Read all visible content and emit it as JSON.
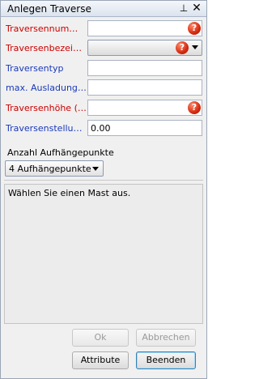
{
  "window": {
    "title": "Anlegen Traverse",
    "pin_glyph": "⊥",
    "close_glyph": "✕"
  },
  "fields": [
    {
      "label": "Traversennummer",
      "value": "",
      "color": "#cc0000",
      "required": true
    },
    {
      "label": "Traversenbezeich...",
      "value": "",
      "color": "#cc0000",
      "required": true,
      "type": "combo"
    },
    {
      "label": "Traversentyp",
      "value": "",
      "color": "#1a39b8",
      "required": false
    },
    {
      "label": "max. Ausladung(m)",
      "value": "",
      "color": "#1a39b8",
      "required": false
    },
    {
      "label": "Traversenhöhe (m)",
      "value": "",
      "color": "#cc0000",
      "required": true
    },
    {
      "label": "Traversenstellung...",
      "value": "0.00",
      "color": "#1a39b8",
      "required": false
    }
  ],
  "required_icon_glyph": "?",
  "aufhaengepunkte": {
    "label": "Anzahl Aufhängepunkte",
    "selected": "4 Aufhängepunkte"
  },
  "message": "Wählen Sie einen Mast aus.",
  "buttons": {
    "ok": "Ok",
    "abbrechen": "Abbrechen",
    "attribute": "Attribute",
    "beenden": "Beenden"
  }
}
